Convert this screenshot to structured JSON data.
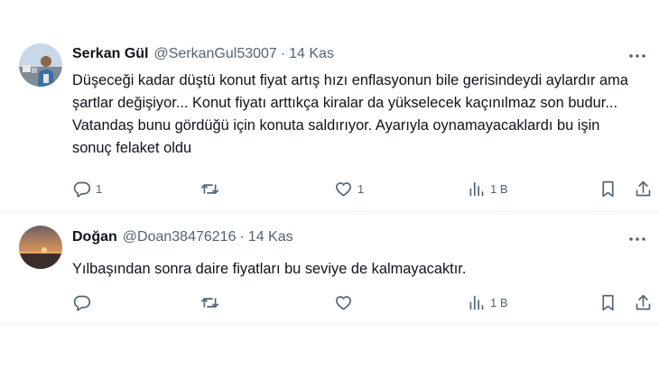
{
  "tweets": [
    {
      "name": "Serkan Gül",
      "handle": "@SerkanGul53007",
      "separator": "·",
      "date": "14 Kas",
      "text": "Düşeceği kadar düştü konut fiyat artış hızı enflasyonun bile gerisindeydi aylardır ama şartlar değişiyor... Konut fiyatı arttıkça kiralar da yükselecek kaçınılmaz son budur... Vatandaş bunu gördüğü için konuta saldırıyor. Ayarıyla oynamayacaklardı bu işin sonuç felaket oldu",
      "replies": "1",
      "retweets": "",
      "likes": "1",
      "views": "1 B",
      "avatar_icon": "profile-photo-man-outdoors"
    },
    {
      "name": "Doğan",
      "handle": "@Doan38476216",
      "separator": "·",
      "date": "14 Kas",
      "text": "Yılbaşından sonra daire fiyatları bu seviye de kalmayacaktır.",
      "replies": "",
      "retweets": "",
      "likes": "",
      "views": "1 B",
      "avatar_icon": "profile-photo-sunset"
    }
  ],
  "icons": {
    "reply": "reply-icon",
    "retweet": "retweet-icon",
    "like": "like-icon",
    "views": "views-icon",
    "bookmark": "bookmark-icon",
    "share": "share-icon",
    "more": "more-icon"
  },
  "colors": {
    "text": "#0f1419",
    "secondary": "#536471",
    "divider": "#eff3f4"
  }
}
